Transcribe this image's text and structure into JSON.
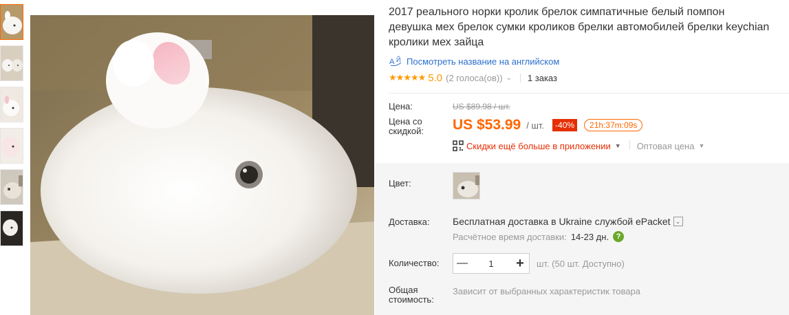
{
  "product": {
    "title_line1": "2017 реального норки кролик брелок симпатичные белый помпон",
    "title_line2": "девушка мех брелок сумки кроликов брелки автомобилей брелки keychian",
    "title_line3": "кролики мех зайца",
    "translate_link": "Посмотреть название на английском",
    "translate_icon": "translate-icon",
    "stars": "★★★★★",
    "rating": "5.0",
    "votes": "(2 голоса(ов))",
    "orders": "1 заказ"
  },
  "price": {
    "label": "Цена:",
    "original": "US $89.98 / шт.",
    "discount_label": "Цена со скидкой:",
    "value": "US $53.99",
    "unit": "/ шт.",
    "discount_badge": "-40%",
    "timer": "21h:37m:09s",
    "app_promo": "Скидки ещё больше в приложении",
    "wholesale": "Оптовая цена"
  },
  "options": {
    "color_label": "Цвет:",
    "delivery_label": "Доставка:",
    "delivery_text": "Бесплатная доставка в Ukraine службой ePacket",
    "delivery_estimate_label": "Расчётное время доставки:",
    "delivery_days": "14-23 дн.",
    "quantity_label": "Количество:",
    "quantity_value": "1",
    "quantity_note": "шт. (50 шт. Доступно)",
    "total_label": "Общая стоимость:",
    "total_text": "Зависит от выбранных характеристик товара"
  },
  "colors": {
    "accent": "#ff6600",
    "link": "#2b6fce",
    "sale_red": "#e62e04",
    "star": "#ff9900"
  }
}
